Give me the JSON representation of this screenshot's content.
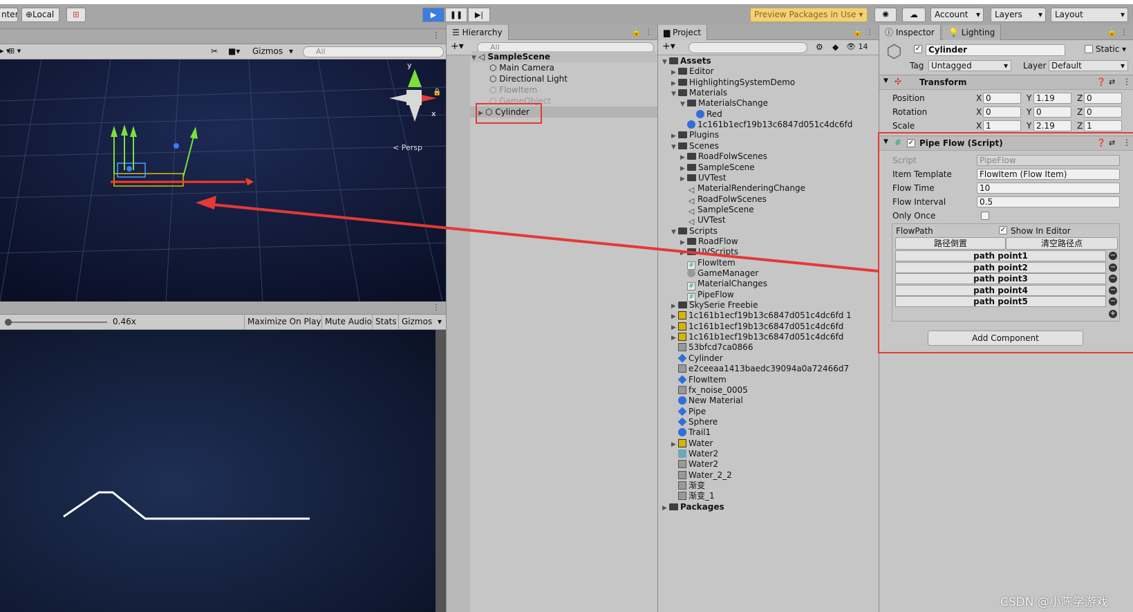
{
  "toolbar": {
    "center_label": "nter",
    "local_label": "Local",
    "play": "▶",
    "pause": "❚❚",
    "step": "▶|",
    "preview_packages": "Preview Packages in Use ▾",
    "account": "Account",
    "layers": "Layers",
    "layout": "Layout"
  },
  "scene": {
    "gizmos": "Gizmos",
    "search_placeholder": "All",
    "axis_y": "y",
    "axis_x": "x",
    "persp": "< Persp"
  },
  "game": {
    "zoom": "0.46x",
    "maximize": "Maximize On Play",
    "mute": "Mute Audio",
    "stats": "Stats",
    "gizmos": "Gizmos"
  },
  "hierarchy": {
    "tab": "Hierarchy",
    "search_placeholder": "All",
    "scene": "SampleScene",
    "items": [
      "Main Camera",
      "Directional Light",
      "FlowItem",
      "GameObject",
      "Cylinder"
    ]
  },
  "project": {
    "tab": "Project",
    "hidden_count": "14",
    "items": [
      {
        "label": "Assets",
        "bold": true
      },
      {
        "label": "Editor"
      },
      {
        "label": "HighlightingSystemDemo"
      },
      {
        "label": "Materials"
      },
      {
        "label": "MaterialsChange"
      },
      {
        "label": "Red"
      },
      {
        "label": "1c161b1ecf19b13c6847d051c4dc6fd"
      },
      {
        "label": "Plugins"
      },
      {
        "label": "Scenes"
      },
      {
        "label": "RoadFolwScenes"
      },
      {
        "label": "SampleScene"
      },
      {
        "label": "UVTest"
      },
      {
        "label": "MaterialRenderingChange"
      },
      {
        "label": "RoadFolwScenes"
      },
      {
        "label": "SampleScene"
      },
      {
        "label": "UVTest"
      },
      {
        "label": "Scripts"
      },
      {
        "label": "RoadFlow"
      },
      {
        "label": "UVScripts"
      },
      {
        "label": "FlowItem"
      },
      {
        "label": "GameManager"
      },
      {
        "label": "MaterialChanges"
      },
      {
        "label": "PipeFlow"
      },
      {
        "label": "SkySerie Freebie"
      },
      {
        "label": "1c161b1ecf19b13c6847d051c4dc6fd 1"
      },
      {
        "label": "1c161b1ecf19b13c6847d051c4dc6fd"
      },
      {
        "label": "1c161b1ecf19b13c6847d051c4dc6fd"
      },
      {
        "label": "53bfcd7ca0866"
      },
      {
        "label": "Cylinder"
      },
      {
        "label": "e2ceeaa1413baedc39094a0a72466d7"
      },
      {
        "label": "FlowItem"
      },
      {
        "label": "fx_noise_0005"
      },
      {
        "label": "New Material"
      },
      {
        "label": "Pipe"
      },
      {
        "label": "Sphere"
      },
      {
        "label": "Trail1"
      },
      {
        "label": "Water"
      },
      {
        "label": "Water2"
      },
      {
        "label": "Water2"
      },
      {
        "label": "Water_2_2"
      },
      {
        "label": "渐变"
      },
      {
        "label": "渐变_1"
      },
      {
        "label": "Packages",
        "bold": true
      }
    ]
  },
  "inspector": {
    "tab": "Inspector",
    "tab2": "Lighting",
    "object_name": "Cylinder",
    "static": "Static ▾",
    "tag_label": "Tag",
    "tag_value": "Untagged",
    "layer_label": "Layer",
    "layer_value": "Default",
    "transform": {
      "title": "Transform",
      "position": "Position",
      "rotation": "Rotation",
      "scale": "Scale",
      "pos": [
        "0",
        "1.19",
        "0"
      ],
      "rot": [
        "0",
        "0",
        "0"
      ],
      "scl": [
        "1",
        "2.19",
        "1"
      ]
    },
    "pipeflow": {
      "title": "Pipe Flow (Script)",
      "script_label": "Script",
      "script_value": "PipeFlow",
      "item_template_label": "Item Template",
      "item_template_value": "FlowItem (Flow Item)",
      "flow_time_label": "Flow Time",
      "flow_time_value": "10",
      "flow_interval_label": "Flow Interval",
      "flow_interval_value": "0.5",
      "only_once_label": "Only Once",
      "flowpath_label": "FlowPath",
      "show_in_editor": "Show In Editor",
      "reverse_btn": "路径倒置",
      "clear_btn": "清空路径点",
      "points": [
        "path point1",
        "path point2",
        "path point3",
        "path point4",
        "path point5"
      ]
    },
    "add_component": "Add Component"
  },
  "watermark": "CSDN @小陈学游戏",
  "colors": {
    "accent_red": "#e53935",
    "play_blue": "#3b7de0"
  }
}
